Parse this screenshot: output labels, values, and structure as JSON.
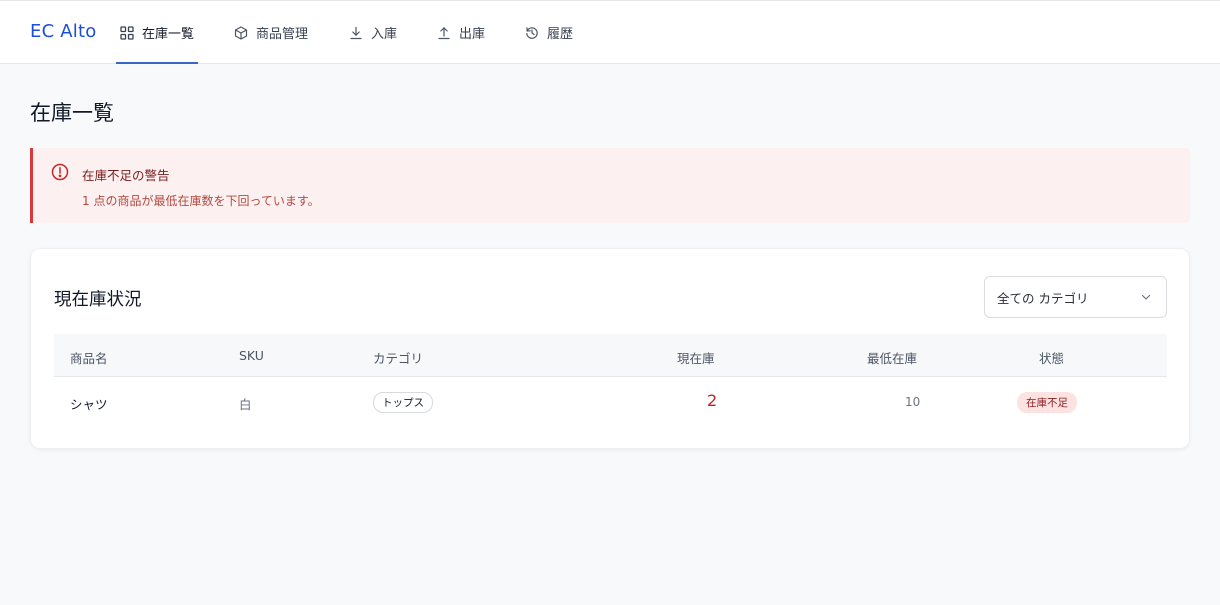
{
  "app": {
    "brand": "EC Alto"
  },
  "nav": {
    "tabs": [
      {
        "label": "在庫一覧",
        "icon": "grid-icon",
        "active": true
      },
      {
        "label": "商品管理",
        "icon": "box-icon",
        "active": false
      },
      {
        "label": "入庫",
        "icon": "download-icon",
        "active": false
      },
      {
        "label": "出庫",
        "icon": "upload-icon",
        "active": false
      },
      {
        "label": "履歴",
        "icon": "history-icon",
        "active": false
      }
    ]
  },
  "page": {
    "title": "在庫一覧"
  },
  "alert": {
    "icon": "alert-circle-icon",
    "title": "在庫不足の警告",
    "message": "1 点の商品が最低在庫数を下回っています。",
    "color": "#d9393b"
  },
  "inventory": {
    "title": "現在庫状況",
    "category_filter": {
      "selected": "全ての カテゴリ"
    },
    "columns": [
      "商品名",
      "SKU",
      "カテゴリ",
      "現在庫",
      "最低在庫",
      "状態"
    ],
    "rows": [
      {
        "name": "シャツ",
        "sku": "白",
        "category": "トップス",
        "current_stock": "2",
        "min_stock": "10",
        "status": "在庫不足"
      }
    ]
  },
  "colors": {
    "brand": "#1d4ed8",
    "active_tab": "#3b64c8",
    "low_stock_text": "#c42323",
    "status_badge_bg": "#fde2e2"
  }
}
